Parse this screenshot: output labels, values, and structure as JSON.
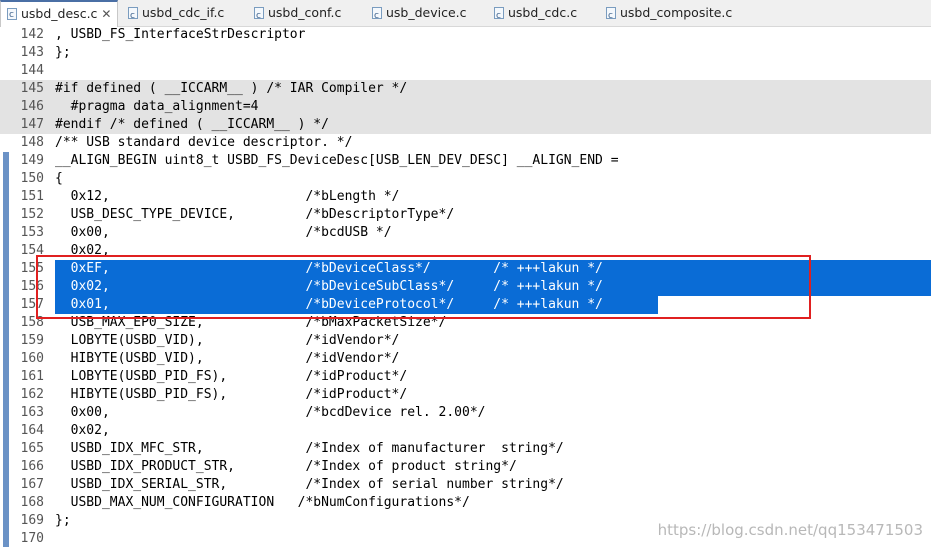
{
  "tabs": [
    {
      "label": "usbd_desc.c",
      "active": true,
      "closable": true
    },
    {
      "label": "usbd_cdc_if.c"
    },
    {
      "label": "usbd_conf.c"
    },
    {
      "label": "usb_device.c"
    },
    {
      "label": "usbd_cdc.c"
    },
    {
      "label": "usbd_composite.c"
    }
  ],
  "code_lines": [
    {
      "num": "142",
      "text": ", USBD_FS_InterfaceStrDescriptor"
    },
    {
      "num": "143",
      "text": "};"
    },
    {
      "num": "144",
      "text": ""
    },
    {
      "num": "145",
      "text": "#if defined ( __ICCARM__ ) /* IAR Compiler */"
    },
    {
      "num": "146",
      "text": "  #pragma data_alignment=4"
    },
    {
      "num": "147",
      "text": "#endif /* defined ( __ICCARM__ ) */"
    },
    {
      "num": "148",
      "text": "/** USB standard device descriptor. */"
    },
    {
      "num": "149",
      "text": "__ALIGN_BEGIN uint8_t USBD_FS_DeviceDesc[USB_LEN_DEV_DESC] __ALIGN_END ="
    },
    {
      "num": "150",
      "text": "{"
    },
    {
      "num": "151",
      "text": "  0x12,                         /*bLength */"
    },
    {
      "num": "152",
      "text": "  USB_DESC_TYPE_DEVICE,         /*bDescriptorType*/"
    },
    {
      "num": "153",
      "text": "  0x00,                         /*bcdUSB */"
    },
    {
      "num": "154",
      "text": "  0x02,"
    },
    {
      "num": "155",
      "text": "  0xEF,                         /*bDeviceClass*/        /* +++lakun */"
    },
    {
      "num": "156",
      "text": "  0x02,                         /*bDeviceSubClass*/     /* +++lakun */"
    },
    {
      "num": "157",
      "text": "  0x01,                         /*bDeviceProtocol*/     /* +++lakun */"
    },
    {
      "num": "158",
      "text": "  USB_MAX_EP0_SIZE,             /*bMaxPacketSize*/"
    },
    {
      "num": "159",
      "text": "  LOBYTE(USBD_VID),             /*idVendor*/"
    },
    {
      "num": "160",
      "text": "  HIBYTE(USBD_VID),             /*idVendor*/"
    },
    {
      "num": "161",
      "text": "  LOBYTE(USBD_PID_FS),          /*idProduct*/"
    },
    {
      "num": "162",
      "text": "  HIBYTE(USBD_PID_FS),          /*idProduct*/"
    },
    {
      "num": "163",
      "text": "  0x00,                         /*bcdDevice rel. 2.00*/"
    },
    {
      "num": "164",
      "text": "  0x02,"
    },
    {
      "num": "165",
      "text": "  USBD_IDX_MFC_STR,             /*Index of manufacturer  string*/"
    },
    {
      "num": "166",
      "text": "  USBD_IDX_PRODUCT_STR,         /*Index of product string*/"
    },
    {
      "num": "167",
      "text": "  USBD_IDX_SERIAL_STR,          /*Index of serial number string*/"
    },
    {
      "num": "168",
      "text": "  USBD_MAX_NUM_CONFIGURATION   /*bNumConfigurations*/"
    },
    {
      "num": "169",
      "text": "};"
    },
    {
      "num": "170",
      "text": ""
    }
  ],
  "watermark": "https://blog.csdn.net/qq153471503",
  "colors": {
    "selection": "#0a6cd6",
    "annotation_box": "#e02020",
    "preproc_bg": "#e3e3e3",
    "change_bar": "#6b92c6"
  }
}
